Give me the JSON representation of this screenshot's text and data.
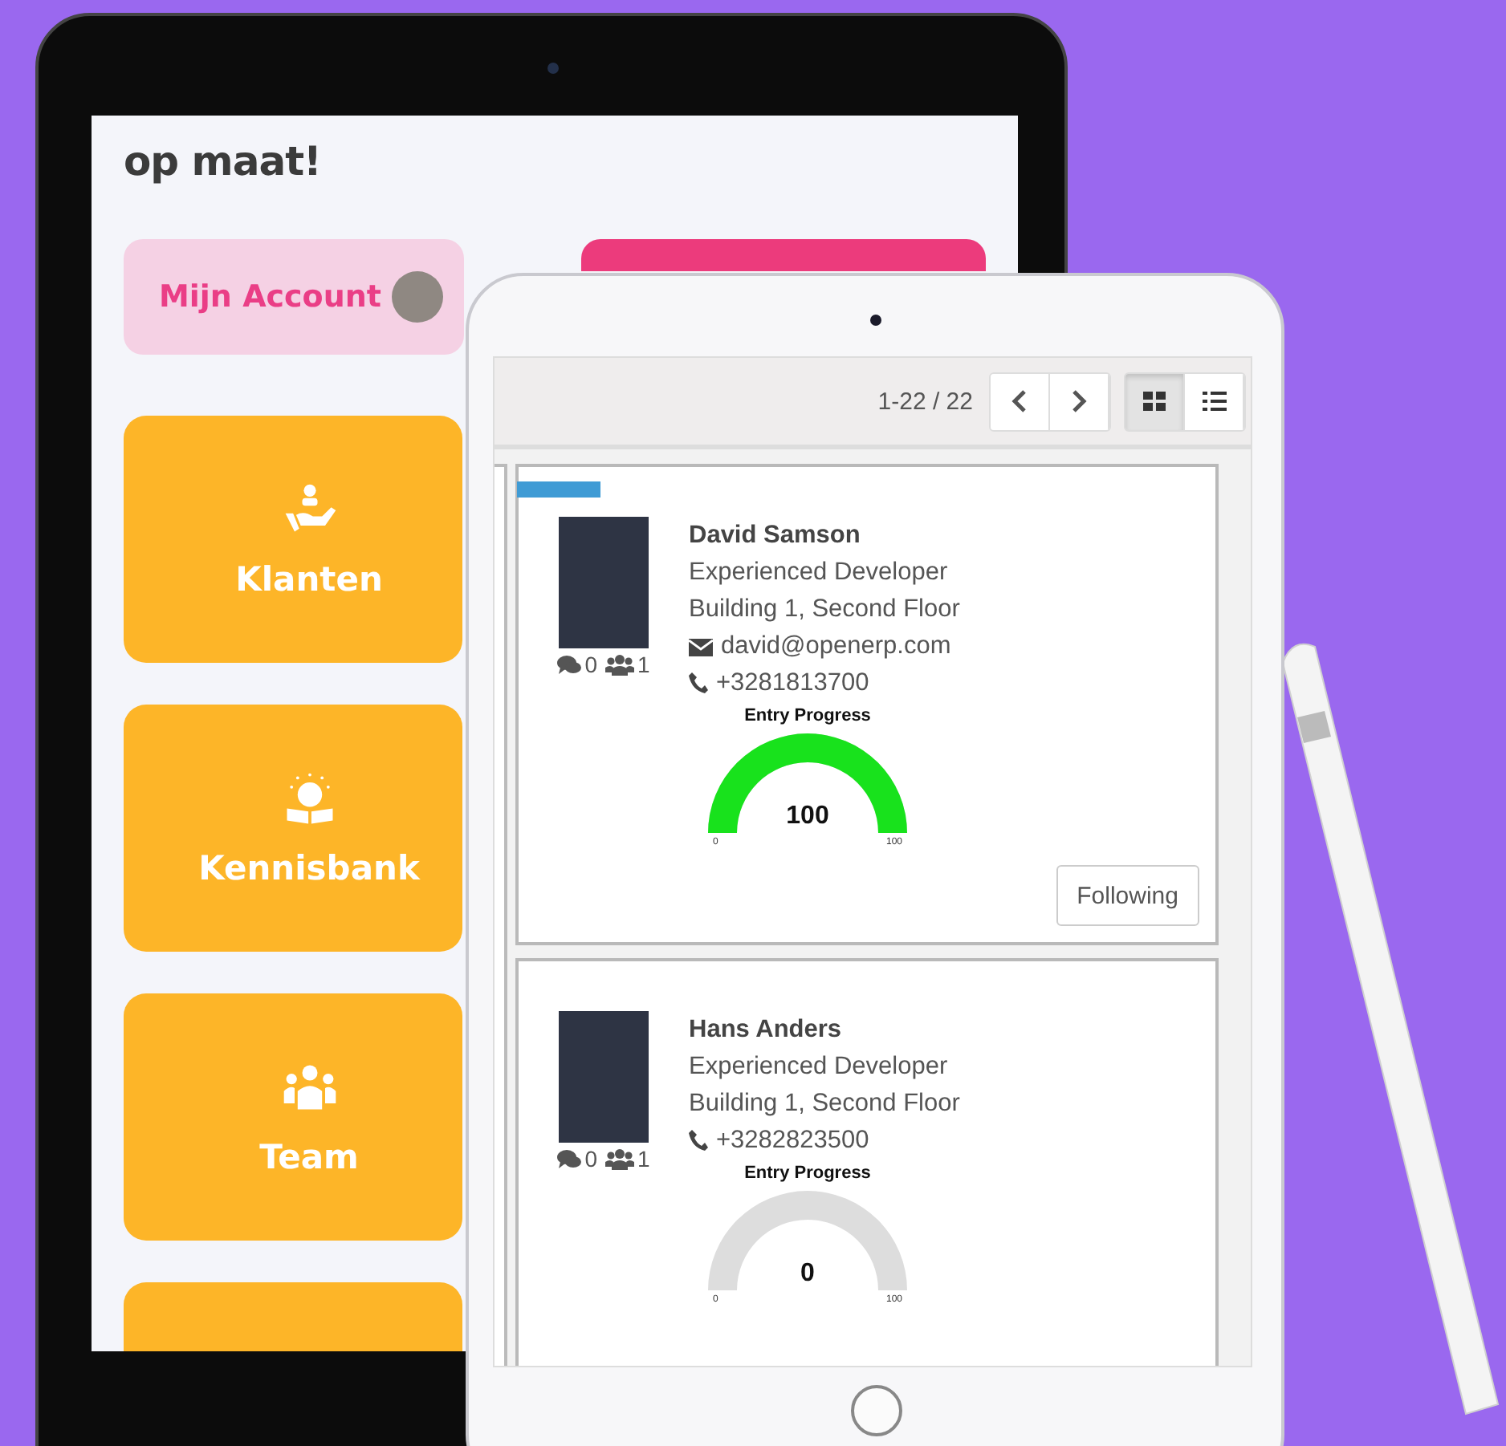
{
  "back_tablet": {
    "heading": "op maat!",
    "account_button": {
      "label": "Mijn Account"
    },
    "tiles": [
      {
        "kind": "customers",
        "label": "Klanten"
      },
      {
        "kind": "knowledge",
        "label": "Kennisbank"
      },
      {
        "kind": "team",
        "label": "Team"
      },
      {
        "kind": "blank"
      }
    ]
  },
  "front_tablet": {
    "pager": "1-22 / 22",
    "view_modes": [
      {
        "kind": "grid",
        "selected": true
      },
      {
        "kind": "list",
        "selected": false
      }
    ],
    "cards": [
      {
        "name": "David Samson",
        "title": "Experienced Developer",
        "location": "Building 1, Second Floor",
        "email": "david@openerp.com",
        "phone": "+3281813700",
        "messages": "0",
        "followers": "1",
        "color": "#3f9bd5",
        "gauge": {
          "title": "Entry Progress",
          "value": "100",
          "level": 1,
          "min": "0",
          "max": "100"
        },
        "follow_button": "Following"
      },
      {
        "name": "Hans Anders",
        "title": "Experienced Developer",
        "location": "Building 1, Second Floor",
        "phone": "+3282823500",
        "messages": "0",
        "followers": "1",
        "gauge": {
          "title": "Entry Progress",
          "value": "0",
          "level": 0,
          "min": "0",
          "max": "100"
        }
      }
    ]
  }
}
